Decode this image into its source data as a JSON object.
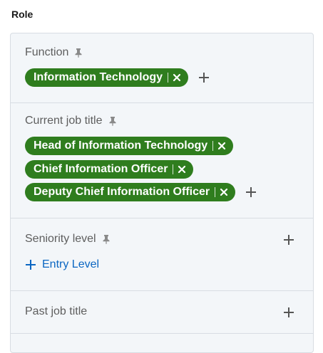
{
  "role": {
    "title": "Role"
  },
  "function": {
    "label": "Function",
    "pills": [
      "Information Technology"
    ]
  },
  "current_job_title": {
    "label": "Current job title",
    "pills": [
      "Head of Information Technology",
      "Chief Information Officer",
      "Deputy Chief Information Officer"
    ]
  },
  "seniority_level": {
    "label": "Seniority level",
    "option": "Entry Level"
  },
  "past_job_title": {
    "label": "Past job title"
  },
  "colors": {
    "pill_bg": "#2f7d1e",
    "link": "#0a66c2",
    "panel_bg": "#f3f6f9"
  },
  "icons": [
    "pin-icon",
    "close-icon",
    "plus-icon"
  ]
}
